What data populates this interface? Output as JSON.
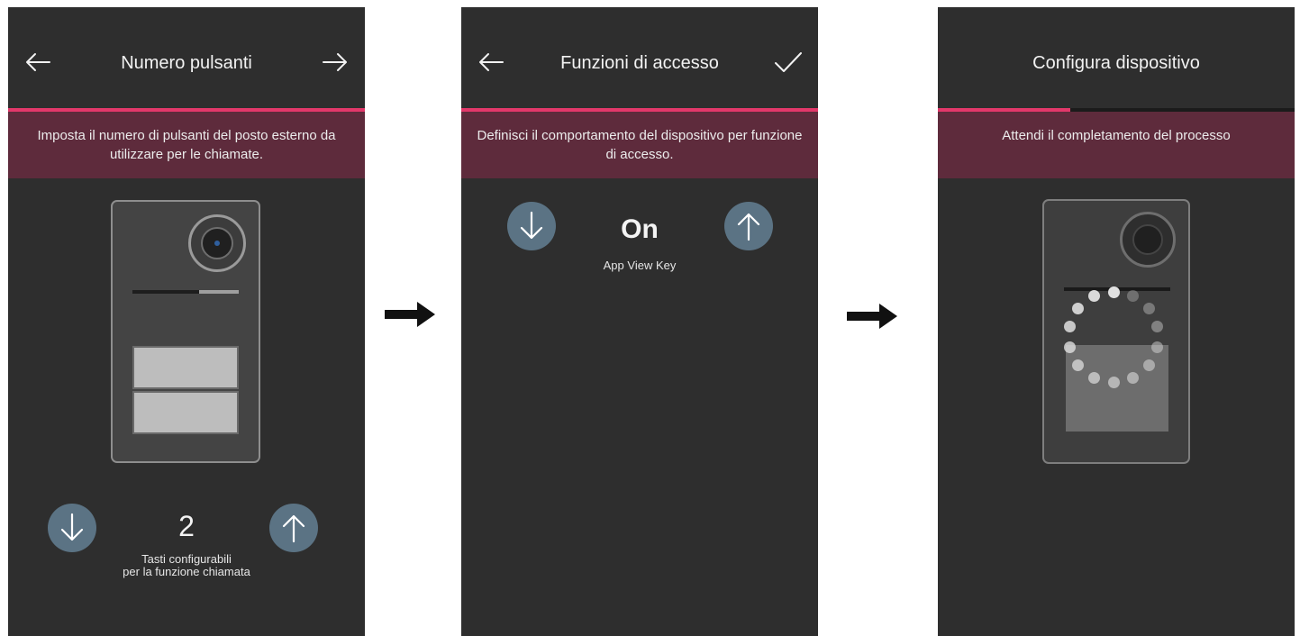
{
  "screens": {
    "buttons_count": {
      "title": "Numero pulsanti",
      "back_icon": "arrow-left-icon",
      "next_icon": "arrow-right-icon",
      "banner": "Imposta il numero di pulsanti del posto esterno da utilizzare per le chiamate.",
      "decrease_icon": "arrow-down-icon",
      "increase_icon": "arrow-up-icon",
      "value": "2",
      "caption_line1": "Tasti configurabili",
      "caption_line2": "per la funzione chiamata"
    },
    "access_functions": {
      "title": "Funzioni di accesso",
      "back_icon": "arrow-left-icon",
      "confirm_icon": "checkmark-icon",
      "banner": "Definisci il comportamento del dispositivo per funzione di accesso.",
      "decrease_icon": "arrow-down-icon",
      "increase_icon": "arrow-up-icon",
      "value": "On",
      "caption": "App View Key"
    },
    "configure_device": {
      "title": "Configura dispositivo",
      "banner": "Attendi il completamento del processo",
      "progress_fraction": 0.37,
      "spinner_icon": "loading-spinner-icon"
    }
  },
  "flow_arrow_icon": "right-arrow-icon",
  "colors": {
    "screen_background": "#2e2e2e",
    "accent": "#e3386a",
    "banner": "#5e2b3c",
    "round_button": "#5b7384"
  }
}
